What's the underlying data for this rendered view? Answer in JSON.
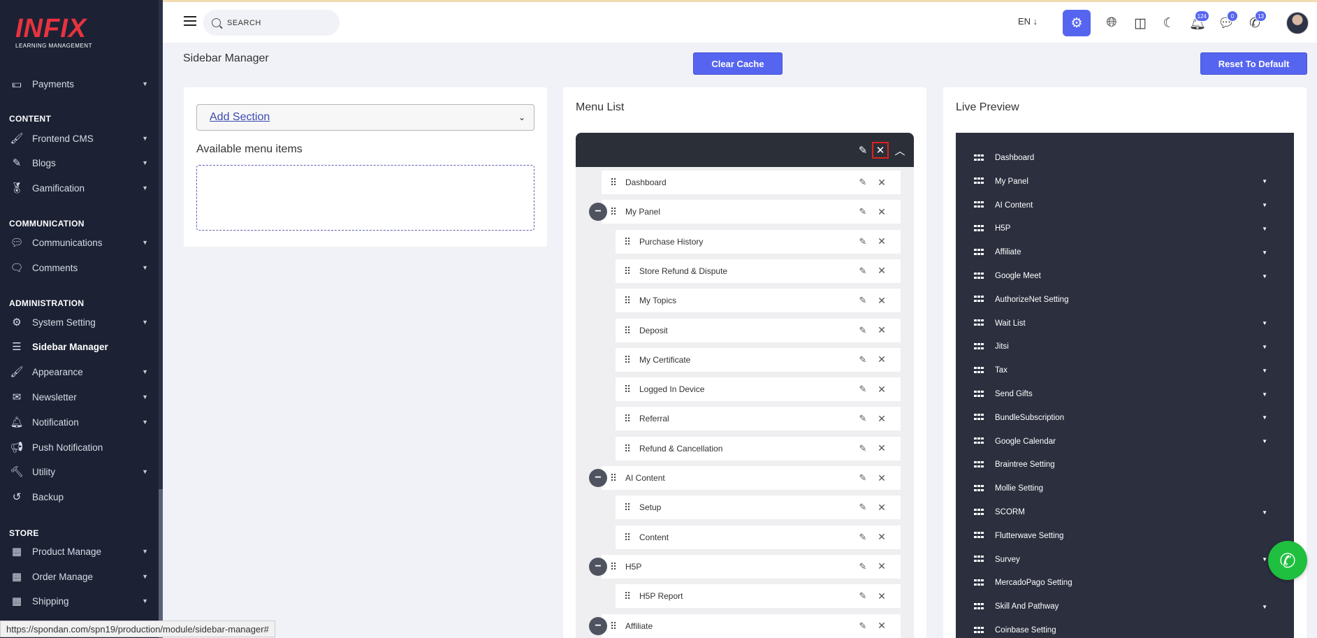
{
  "brand": {
    "logo": "INFIX",
    "tagline": "LEARNING MANAGEMENT"
  },
  "sidebar": {
    "items": [
      {
        "label": "Payments",
        "icon": "payments-icon",
        "caret": true
      },
      {
        "label": "Frontend CMS",
        "icon": "paint-roller-icon",
        "caret": true
      },
      {
        "label": "Blogs",
        "icon": "blog-edit-icon",
        "caret": true
      },
      {
        "label": "Gamification",
        "icon": "medal-icon",
        "caret": true
      },
      {
        "label": "Communications",
        "icon": "chat-icon",
        "caret": true
      },
      {
        "label": "Comments",
        "icon": "comment-icon",
        "caret": true
      },
      {
        "label": "System Setting",
        "icon": "gears-icon",
        "caret": true
      },
      {
        "label": "Sidebar Manager",
        "icon": "bars-icon",
        "caret": false
      },
      {
        "label": "Appearance",
        "icon": "brush-icon",
        "caret": true
      },
      {
        "label": "Newsletter",
        "icon": "newsletter-icon",
        "caret": true
      },
      {
        "label": "Notification",
        "icon": "bell-icon",
        "caret": true
      },
      {
        "label": "Push Notification",
        "icon": "megaphone-icon",
        "caret": false
      },
      {
        "label": "Utility",
        "icon": "hammer-icon",
        "caret": true
      },
      {
        "label": "Backup",
        "icon": "undo-icon",
        "caret": false
      },
      {
        "label": "Product Manage",
        "icon": "grid-icon",
        "caret": true
      },
      {
        "label": "Order Manage",
        "icon": "grid-icon",
        "caret": true
      },
      {
        "label": "Shipping",
        "icon": "grid-icon",
        "caret": true
      }
    ],
    "sections": [
      "CONTENT",
      "COMMUNICATION",
      "ADMINISTRATION",
      "STORE"
    ]
  },
  "header": {
    "search_placeholder": "SEARCH",
    "lang": "EN ↓",
    "badges": {
      "notifications": "124",
      "messages": "0",
      "whatsapp": "13"
    }
  },
  "page": {
    "title": "Sidebar Manager",
    "clear_cache": "Clear Cache",
    "reset_default": "Reset To Default",
    "add_section": "Add Section",
    "available_title": "Available menu items",
    "menu_list_title": "Menu List",
    "live_preview_title": "Live Preview"
  },
  "menu_list": [
    {
      "label": "Dashboard",
      "level": 0,
      "collapse": false
    },
    {
      "label": "My Panel",
      "level": 0,
      "collapse": true
    },
    {
      "label": "Purchase History",
      "level": 1
    },
    {
      "label": "Store Refund & Dispute",
      "level": 1
    },
    {
      "label": "My Topics",
      "level": 1
    },
    {
      "label": "Deposit",
      "level": 1
    },
    {
      "label": "My Certificate",
      "level": 1
    },
    {
      "label": "Logged In Device",
      "level": 1
    },
    {
      "label": "Referral",
      "level": 1
    },
    {
      "label": "Refund & Cancellation",
      "level": 1
    },
    {
      "label": "AI Content",
      "level": 0,
      "collapse": true
    },
    {
      "label": "Setup",
      "level": 1
    },
    {
      "label": "Content",
      "level": 1
    },
    {
      "label": "H5P",
      "level": 0,
      "collapse": true
    },
    {
      "label": "H5P Report",
      "level": 1
    },
    {
      "label": "Affiliate",
      "level": 0,
      "collapse": true
    }
  ],
  "live_preview": [
    {
      "label": "Dashboard",
      "caret": false
    },
    {
      "label": "My Panel",
      "caret": true
    },
    {
      "label": "AI Content",
      "caret": true
    },
    {
      "label": "H5P",
      "caret": true
    },
    {
      "label": "Affiliate",
      "caret": true
    },
    {
      "label": "Google Meet",
      "caret": true
    },
    {
      "label": "AuthorizeNet Setting",
      "caret": false
    },
    {
      "label": "Wait List",
      "caret": true
    },
    {
      "label": "Jitsi",
      "caret": true
    },
    {
      "label": "Tax",
      "caret": true
    },
    {
      "label": "Send Gifts",
      "caret": true
    },
    {
      "label": "BundleSubscription",
      "caret": true
    },
    {
      "label": "Google Calendar",
      "caret": true
    },
    {
      "label": "Braintree Setting",
      "caret": false
    },
    {
      "label": "Mollie Setting",
      "caret": false
    },
    {
      "label": "SCORM",
      "caret": true
    },
    {
      "label": "Flutterwave Setting",
      "caret": false
    },
    {
      "label": "Survey",
      "caret": true
    },
    {
      "label": "MercadoPago Setting",
      "caret": false
    },
    {
      "label": "Skill And Pathway",
      "caret": true
    },
    {
      "label": "Coinbase Setting",
      "caret": false
    }
  ],
  "status_url": "https://spondan.com/spn19/production/module/sidebar-manager#",
  "colors": {
    "accent": "#5665f0",
    "sidebar_bg": "#1c2234",
    "whatsapp": "#1fbf3f",
    "highlight": "#e02020"
  }
}
